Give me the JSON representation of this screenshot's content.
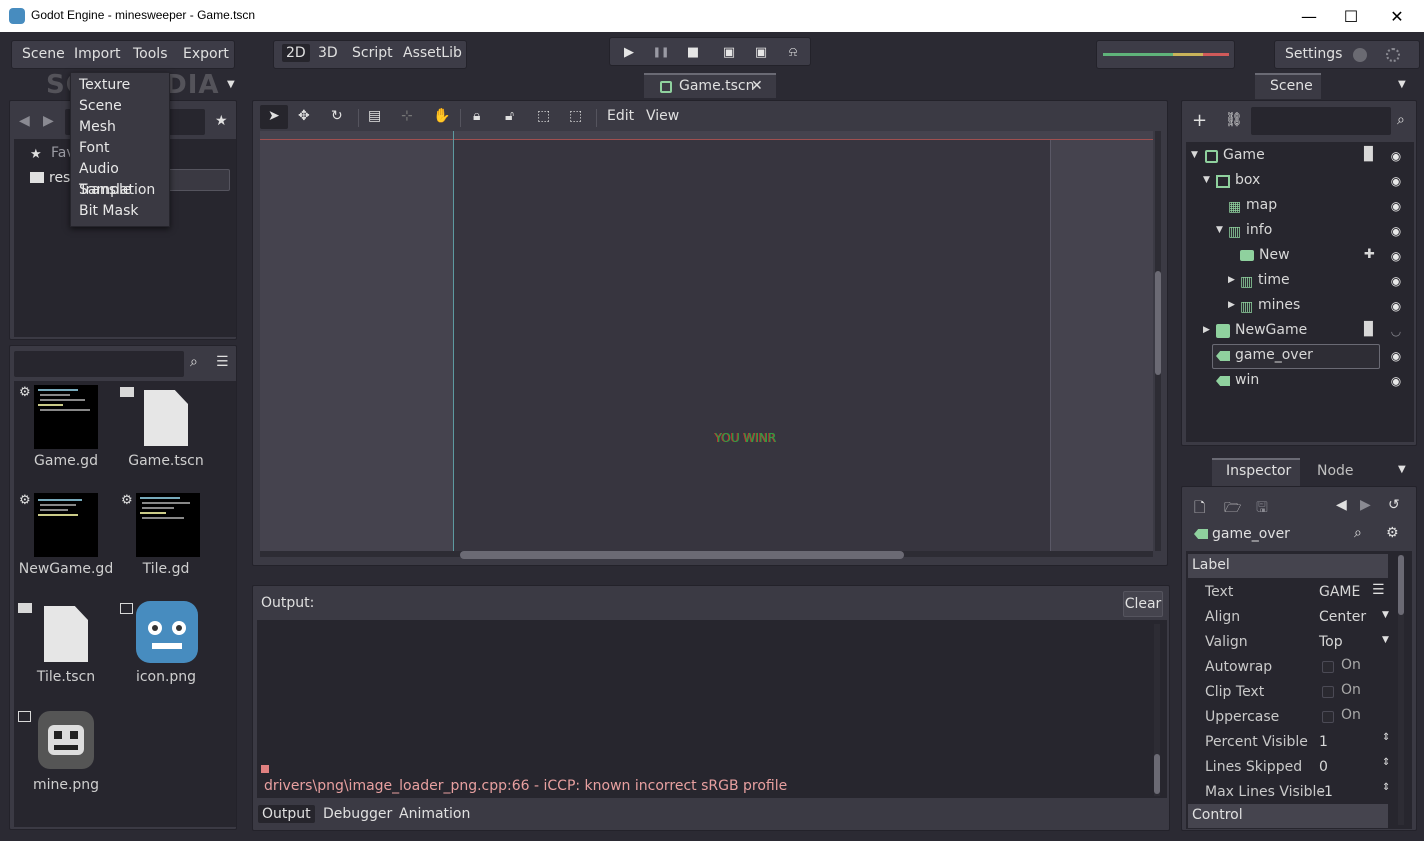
{
  "window": {
    "title": "Godot Engine - minesweeper - Game.tscn",
    "minimize": "—",
    "maximize": "☐",
    "close": "✕"
  },
  "menu": {
    "items": [
      "Scene",
      "Import",
      "Tools",
      "Export"
    ]
  },
  "import_dropdown": [
    "Texture",
    "Scene",
    "Mesh",
    "Font",
    "Audio Sample",
    "Translation",
    "Bit Mask"
  ],
  "watermark": "SOFTPEDIA",
  "modes": [
    "2D",
    "3D",
    "Script",
    "AssetLib"
  ],
  "playback": [
    "▶",
    "❚❚",
    "■",
    "▣",
    "▣",
    "⍾"
  ],
  "settings": {
    "label": "Settings"
  },
  "scene_tab": {
    "label": "Game.tscn",
    "close": "✕"
  },
  "filesystem": {
    "favorites_label": "Fav",
    "res_label": "res:",
    "files": [
      {
        "name": "Game.gd",
        "type": "script"
      },
      {
        "name": "Game.tscn",
        "type": "scene"
      },
      {
        "name": "NewGame.gd",
        "type": "script"
      },
      {
        "name": "Tile.gd",
        "type": "script"
      },
      {
        "name": "Tile.tscn",
        "type": "scene"
      },
      {
        "name": "icon.png",
        "type": "image"
      },
      {
        "name": "mine.png",
        "type": "image"
      }
    ]
  },
  "viewport_toolbar": {
    "edit": "Edit",
    "view": "View"
  },
  "canvas": {
    "label_text": "YOU WINR"
  },
  "output": {
    "title": "Output:",
    "clear": "Clear",
    "message": "drivers\\png\\image_loader_png.cpp:66 - iCCP: known incorrect sRGB profile",
    "tabs": [
      "Output",
      "Debugger",
      "Animation"
    ]
  },
  "scene_dock": {
    "tab": "Scene",
    "tree": [
      {
        "name": "Game",
        "depth": 0,
        "icon": "control-icon"
      },
      {
        "name": "box",
        "depth": 1,
        "icon": "vbox-icon"
      },
      {
        "name": "map",
        "depth": 2,
        "icon": "grid-icon"
      },
      {
        "name": "info",
        "depth": 2,
        "icon": "hbox-icon"
      },
      {
        "name": "New",
        "depth": 3,
        "icon": "button-icon"
      },
      {
        "name": "time",
        "depth": 3,
        "icon": "hbox-icon"
      },
      {
        "name": "mines",
        "depth": 3,
        "icon": "hbox-icon"
      },
      {
        "name": "NewGame",
        "depth": 1,
        "icon": "popup-icon"
      },
      {
        "name": "game_over",
        "depth": 1,
        "icon": "label-icon"
      },
      {
        "name": "win",
        "depth": 1,
        "icon": "label-icon"
      }
    ]
  },
  "inspector": {
    "tabs": [
      "Inspector",
      "Node"
    ],
    "node_name": "game_over",
    "section_label": "Label",
    "section_control": "Control",
    "props": [
      {
        "key": "Text",
        "value": "GAME",
        "kind": "text"
      },
      {
        "key": "Align",
        "value": "Center",
        "kind": "enum"
      },
      {
        "key": "Valign",
        "value": "Top",
        "kind": "enum"
      },
      {
        "key": "Autowrap",
        "value": "On",
        "kind": "check"
      },
      {
        "key": "Clip Text",
        "value": "On",
        "kind": "check"
      },
      {
        "key": "Uppercase",
        "value": "On",
        "kind": "check"
      },
      {
        "key": "Percent Visible",
        "value": "1",
        "kind": "spin"
      },
      {
        "key": "Lines Skipped",
        "value": "0",
        "kind": "spin"
      },
      {
        "key": "Max Lines Visible",
        "value": "-1",
        "kind": "spin"
      }
    ]
  },
  "colors": {
    "accent": "#478cbf",
    "panel": "#3b3a44",
    "dark": "#27262e",
    "error": "#e08080"
  }
}
